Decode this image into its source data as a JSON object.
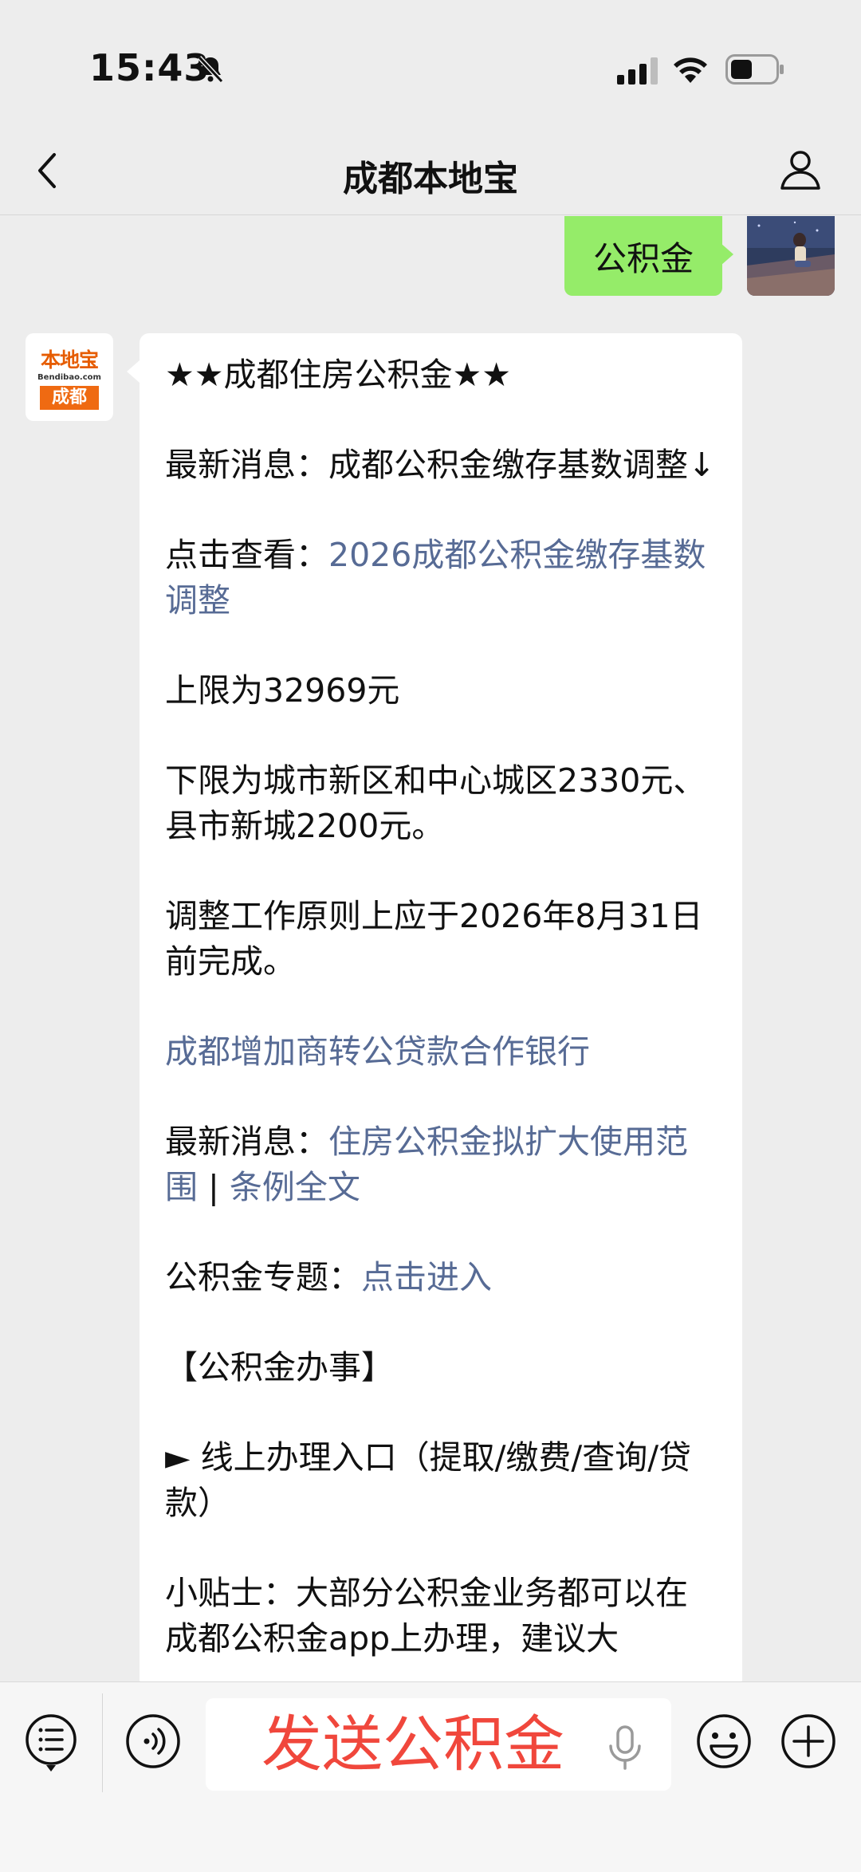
{
  "status_bar": {
    "time": "15:43"
  },
  "nav": {
    "title": "成都本地宝"
  },
  "sent_message": {
    "text": "公积金"
  },
  "bot": {
    "logo_top": "本地宝",
    "logo_url": "Bendibao.com",
    "logo_city": "成都"
  },
  "reply": {
    "headline": "★★成都住房公积金★★",
    "news1": "最新消息：成都公积金缴存基数调整↓",
    "view_prefix": "点击查看：",
    "view_link": "2026成都公积金缴存基数调整",
    "upper_limit": "上限为32969元",
    "lower_limit": "下限为城市新区和中心城区2330元、县市新城2200元。",
    "deadline": "调整工作原则上应于2026年8月31日前完成。",
    "bank_link": "成都增加商转公贷款合作银行",
    "news2_prefix": "最新消息：",
    "news2_link": "住房公积金拟扩大使用范围",
    "separator": " | ",
    "regulation_link": "条例全文",
    "topic_prefix": "公积金专题：",
    "topic_link": "点击进入",
    "section_title": "【公积金办事】",
    "online_entry": "► 线上办理入口（提取/缴费/查询/贷款）",
    "tip": "小贴士：大部分公积金业务都可以在成都公积金app上办理，建议大"
  },
  "input": {
    "text": "发送公积金"
  }
}
